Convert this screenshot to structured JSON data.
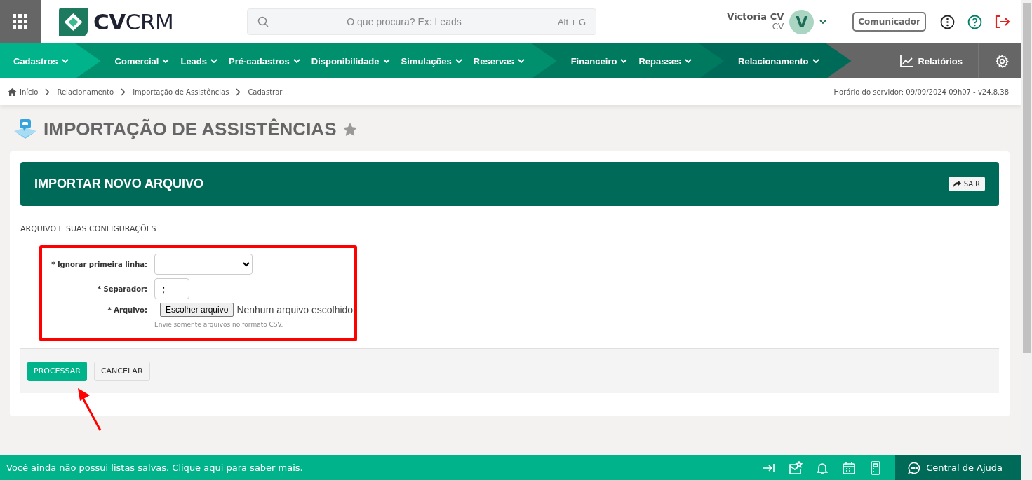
{
  "header": {
    "search": {
      "placeholder": "O que procura? Ex: Leads",
      "shortcut": "Alt + G"
    },
    "user": {
      "name": "Victoria CV",
      "role": "CV",
      "initial": "V"
    },
    "communicator_button": "Comunicador",
    "logo": {
      "bold": "CV",
      "light": "CRM"
    }
  },
  "nav": {
    "groups": [
      {
        "color": "#00b38a",
        "items": [
          "Cadastros"
        ]
      },
      {
        "color": "#00906e",
        "items": [
          "Comercial",
          "Leads",
          "Pré-cadastros",
          "Disponibilidade",
          "Simulações",
          "Reservas"
        ]
      },
      {
        "color": "#007a5f",
        "items": [
          "Financeiro",
          "Repasses"
        ]
      },
      {
        "color": "#006a59",
        "items": [
          "Relacionamento"
        ]
      }
    ],
    "reports": "Relatórios"
  },
  "breadcrumb": [
    "Início",
    "Relacionamento",
    "Importação de Assistências",
    "Cadastrar"
  ],
  "server_time": "Horário do servidor: 09/09/2024 09h07 - v24.8.38",
  "page_title": "IMPORTAÇÃO DE ASSISTÊNCIAS",
  "panel": {
    "title": "IMPORTAR NOVO ARQUIVO",
    "exit_button": "SAIR",
    "section": "ARQUIVO E SUAS CONFIGURAÇÕES",
    "fields": [
      {
        "kind": "select",
        "label": "* Ignorar primeira linha:"
      },
      {
        "kind": "text",
        "label": "* Separador:",
        "value": ";"
      },
      {
        "kind": "file",
        "label": "* Arquivo:",
        "button": "Escolher arquivo",
        "status": "Nenhum arquivo escolhido",
        "hint": "Envie somente arquivos no formato CSV."
      }
    ],
    "buttons": [
      {
        "kind": "primary",
        "label": "PROCESSAR"
      },
      {
        "kind": "secondary",
        "label": "CANCELAR"
      }
    ]
  },
  "status_bar": {
    "message": "Você ainda não possui listas salvas. Clique aqui para saber mais.",
    "help": "Central de Ajuda"
  }
}
